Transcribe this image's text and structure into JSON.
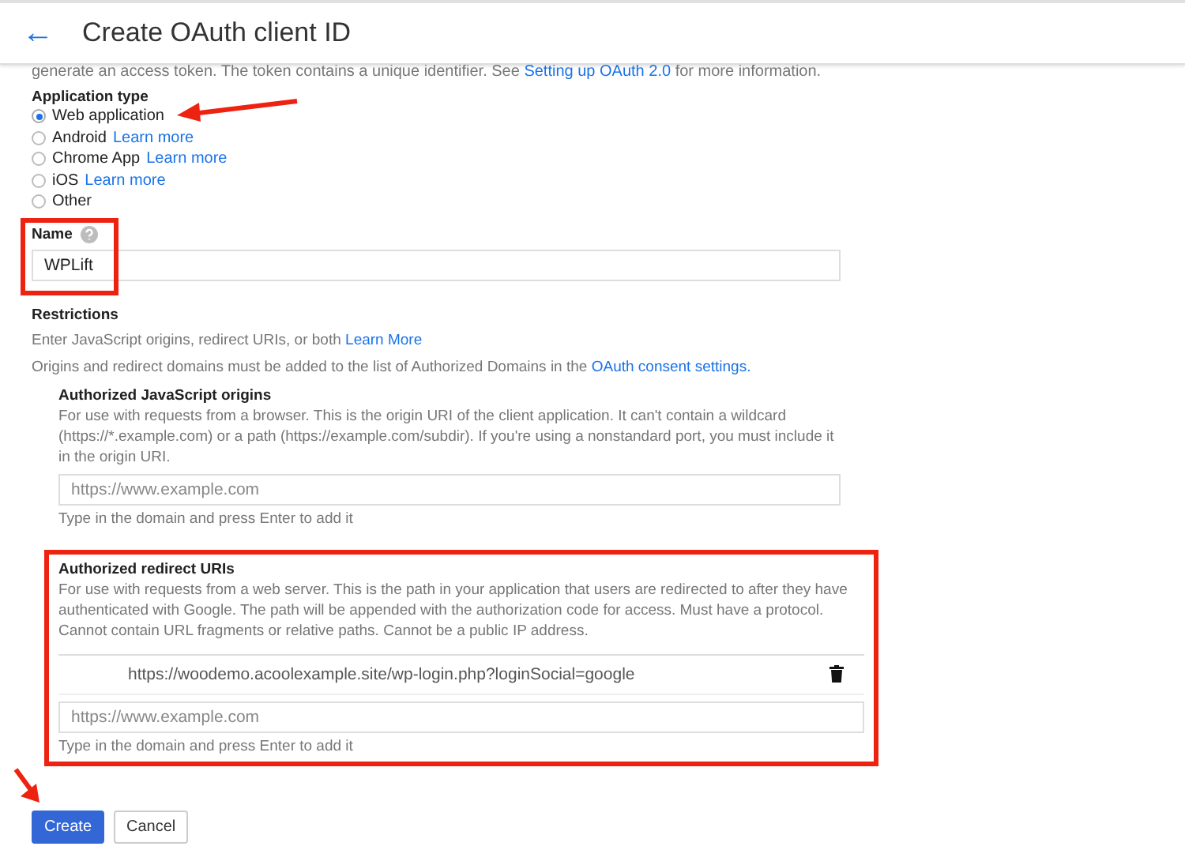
{
  "header": {
    "back_icon": "←",
    "title": "Create OAuth client ID"
  },
  "intro": {
    "text": "generate an access token. The token contains a unique identifier. See",
    "link": "Setting up OAuth 2.0",
    "end": "for more information."
  },
  "application_type": {
    "label": "Application type",
    "options": [
      {
        "label": "Web application",
        "selected": true
      },
      {
        "label": "Android",
        "link": "Learn more",
        "selected": false
      },
      {
        "label": "Chrome App",
        "link": "Learn more",
        "selected": false
      },
      {
        "label": "iOS",
        "link": "Learn more",
        "selected": false
      },
      {
        "label": "Other",
        "selected": false
      }
    ]
  },
  "name": {
    "label": "Name",
    "value": "WPLift"
  },
  "restrictions": {
    "title": "Restrictions",
    "line_1": "Enter JavaScript origins, redirect URIs, or both",
    "line_1_link": "Learn More",
    "line_2": "Origins and redirect domains must be added to the list of Authorized Domains in the",
    "line_2_link": "OAuth consent settings."
  },
  "js_origins": {
    "title": "Authorized JavaScript origins",
    "description": "For use with requests from a browser. This is the origin URI of the client application. It can't contain a wildcard (https://*.example.com) or a path (https://example.com/subdir). If you're using a nonstandard port, you must include it in the origin URI.",
    "placeholder": "https://www.example.com",
    "hint": "Type in the domain and press Enter to add it"
  },
  "redirect_uris": {
    "title": "Authorized redirect URIs",
    "description": "For use with requests from a web server. This is the path in your application that users are redirected to after they have authenticated with Google. The path will be appended with the authorization code for access. Must have a protocol. Cannot contain URL fragments or relative paths. Cannot be a public IP address.",
    "entries": [
      "https://woodemo.acoolexample.site/wp-login.php?loginSocial=google"
    ],
    "placeholder": "https://www.example.com",
    "hint": "Type in the domain and press Enter to add it"
  },
  "buttons": [
    {
      "label": "Create",
      "kind": "primary"
    },
    {
      "label": "Cancel",
      "kind": "secondary"
    }
  ]
}
